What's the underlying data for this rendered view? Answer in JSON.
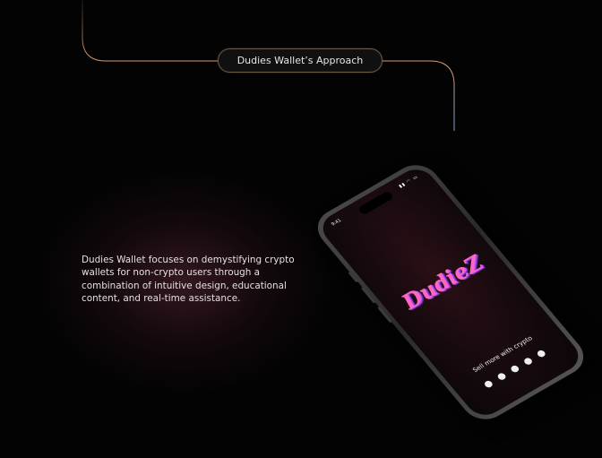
{
  "heading": {
    "label": "Dudies Wallet’s Approach"
  },
  "description": "Dudies Wallet focuses on demystifying crypto wallets for non-crypto users through a combination of intuitive design, educational content, and real-time assistance.",
  "phone": {
    "time": "9:41",
    "logo_text": "DudieZ",
    "tagline": "Sell more with crypto",
    "coin_icons": [
      "coin-icon",
      "coin-icon",
      "coin-icon",
      "coin-icon",
      "coin-icon"
    ]
  },
  "colors": {
    "background": "#030303",
    "line": "#d89a6a",
    "logo": "#ff66c4"
  }
}
